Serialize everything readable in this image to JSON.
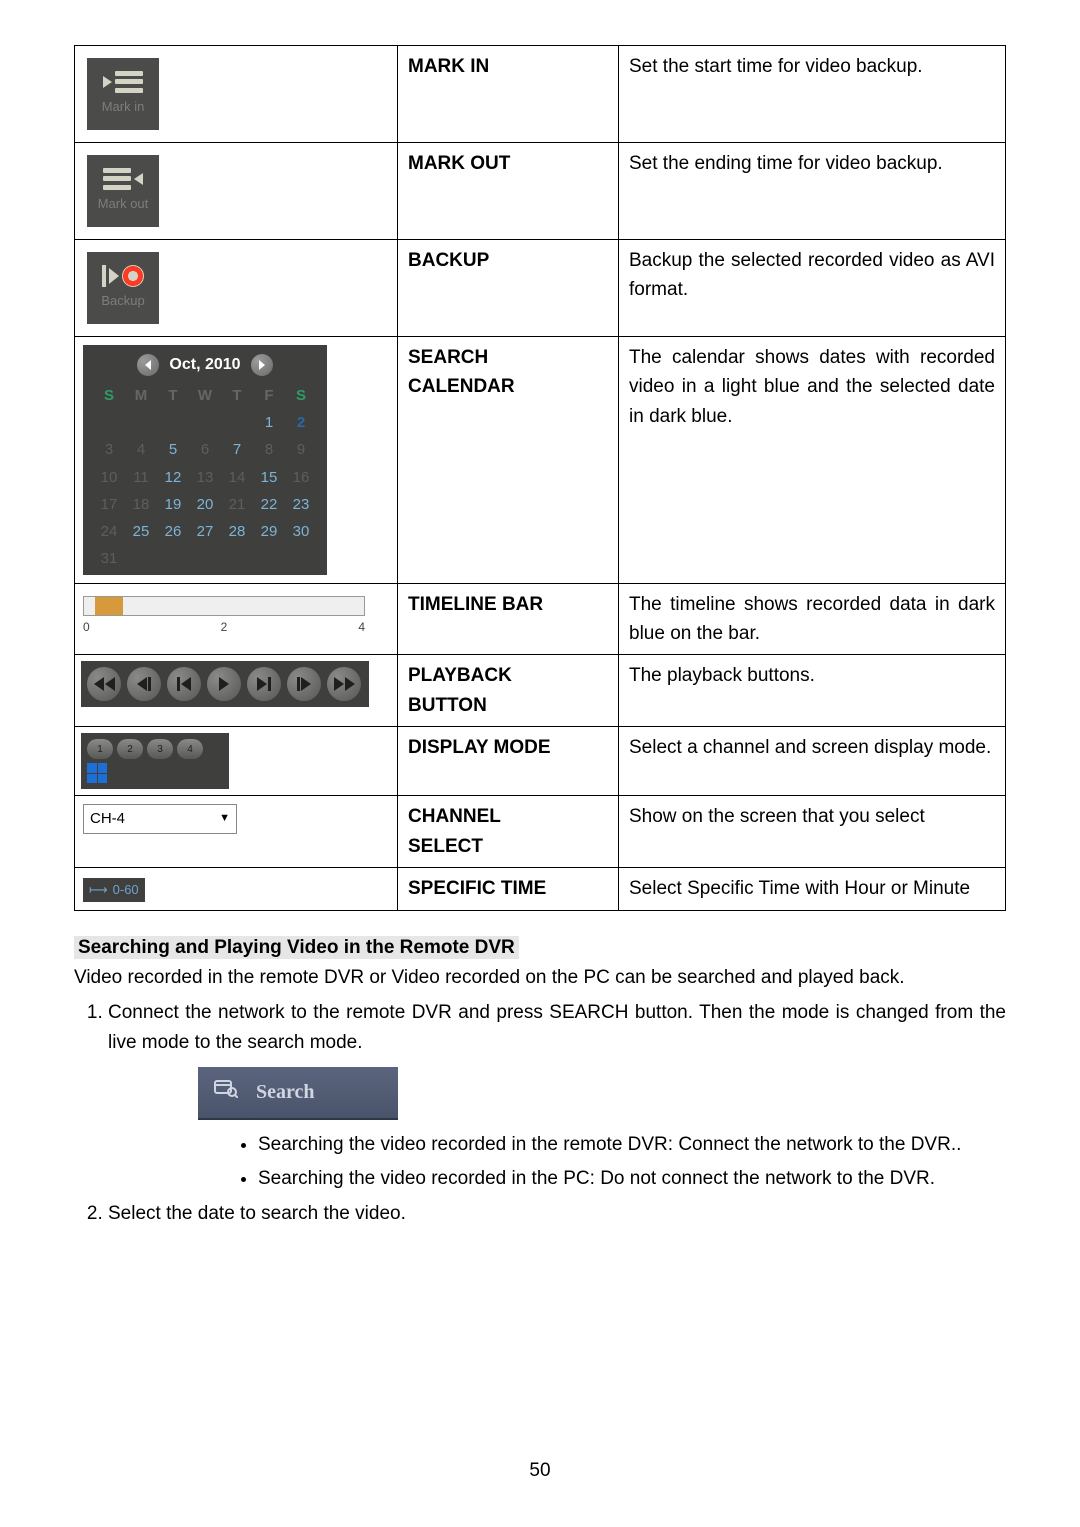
{
  "page_number": "50",
  "table": {
    "rows": [
      {
        "icon_label": "Mark in",
        "name": "MARK IN",
        "desc": "Set the start time for video backup."
      },
      {
        "icon_label": "Mark out",
        "name": "MARK OUT",
        "desc": "Set the ending time for video backup."
      },
      {
        "icon_label": "Backup",
        "name": "BACKUP",
        "desc": "Backup the selected recorded video as AVI format."
      },
      {
        "name": "SEARCH CALENDAR",
        "name_l1": "SEARCH",
        "name_l2": "CALENDAR",
        "desc": "The calendar shows dates with recorded video in a light blue and the selected date in dark blue."
      },
      {
        "name": "TIMELINE BAR",
        "desc": "The timeline shows recorded data in dark blue on the bar."
      },
      {
        "name": "PLAYBACK BUTTON",
        "name_l1": "PLAYBACK",
        "name_l2": "BUTTON",
        "desc": "The playback buttons."
      },
      {
        "name": "DISPLAY MODE",
        "desc": "Select a channel and screen display mode."
      },
      {
        "name": "CHANNEL SELECT",
        "name_l1": "CHANNEL",
        "name_l2": "SELECT",
        "desc": "Show on the screen that you select"
      },
      {
        "name": "SPECIFIC TIME",
        "desc": "Select Specific Time with Hour or Minute"
      }
    ]
  },
  "calendar": {
    "title": "Oct, 2010",
    "dow": [
      "S",
      "M",
      "T",
      "W",
      "T",
      "F",
      "S"
    ],
    "leading_blanks": 5,
    "days": 31,
    "recorded": [
      1,
      5,
      7,
      12,
      15,
      19,
      20,
      22,
      23,
      25,
      26,
      27,
      28,
      29,
      30
    ],
    "selected": [
      2
    ]
  },
  "timeline": {
    "labels": [
      "0",
      "2",
      "4"
    ]
  },
  "display_mode": {
    "labels": [
      "1",
      "2",
      "3",
      "4"
    ]
  },
  "channel_select": {
    "value": "CH-4"
  },
  "specific_time": {
    "value": "0-60"
  },
  "section": {
    "heading": "Searching and Playing Video in the Remote DVR",
    "intro": "Video recorded in the remote DVR or Video recorded on the PC can be searched and played back.",
    "step1": "Connect the network to the remote DVR and press SEARCH button. Then the mode is changed from the live mode to the search mode.",
    "search_button": "Search",
    "bullet1": "Searching the video recorded in the remote DVR: Connect the network to the DVR..",
    "bullet2": "Searching the video recorded in the PC: Do not connect the network to the DVR.",
    "step2": "Select the date to search the video."
  }
}
